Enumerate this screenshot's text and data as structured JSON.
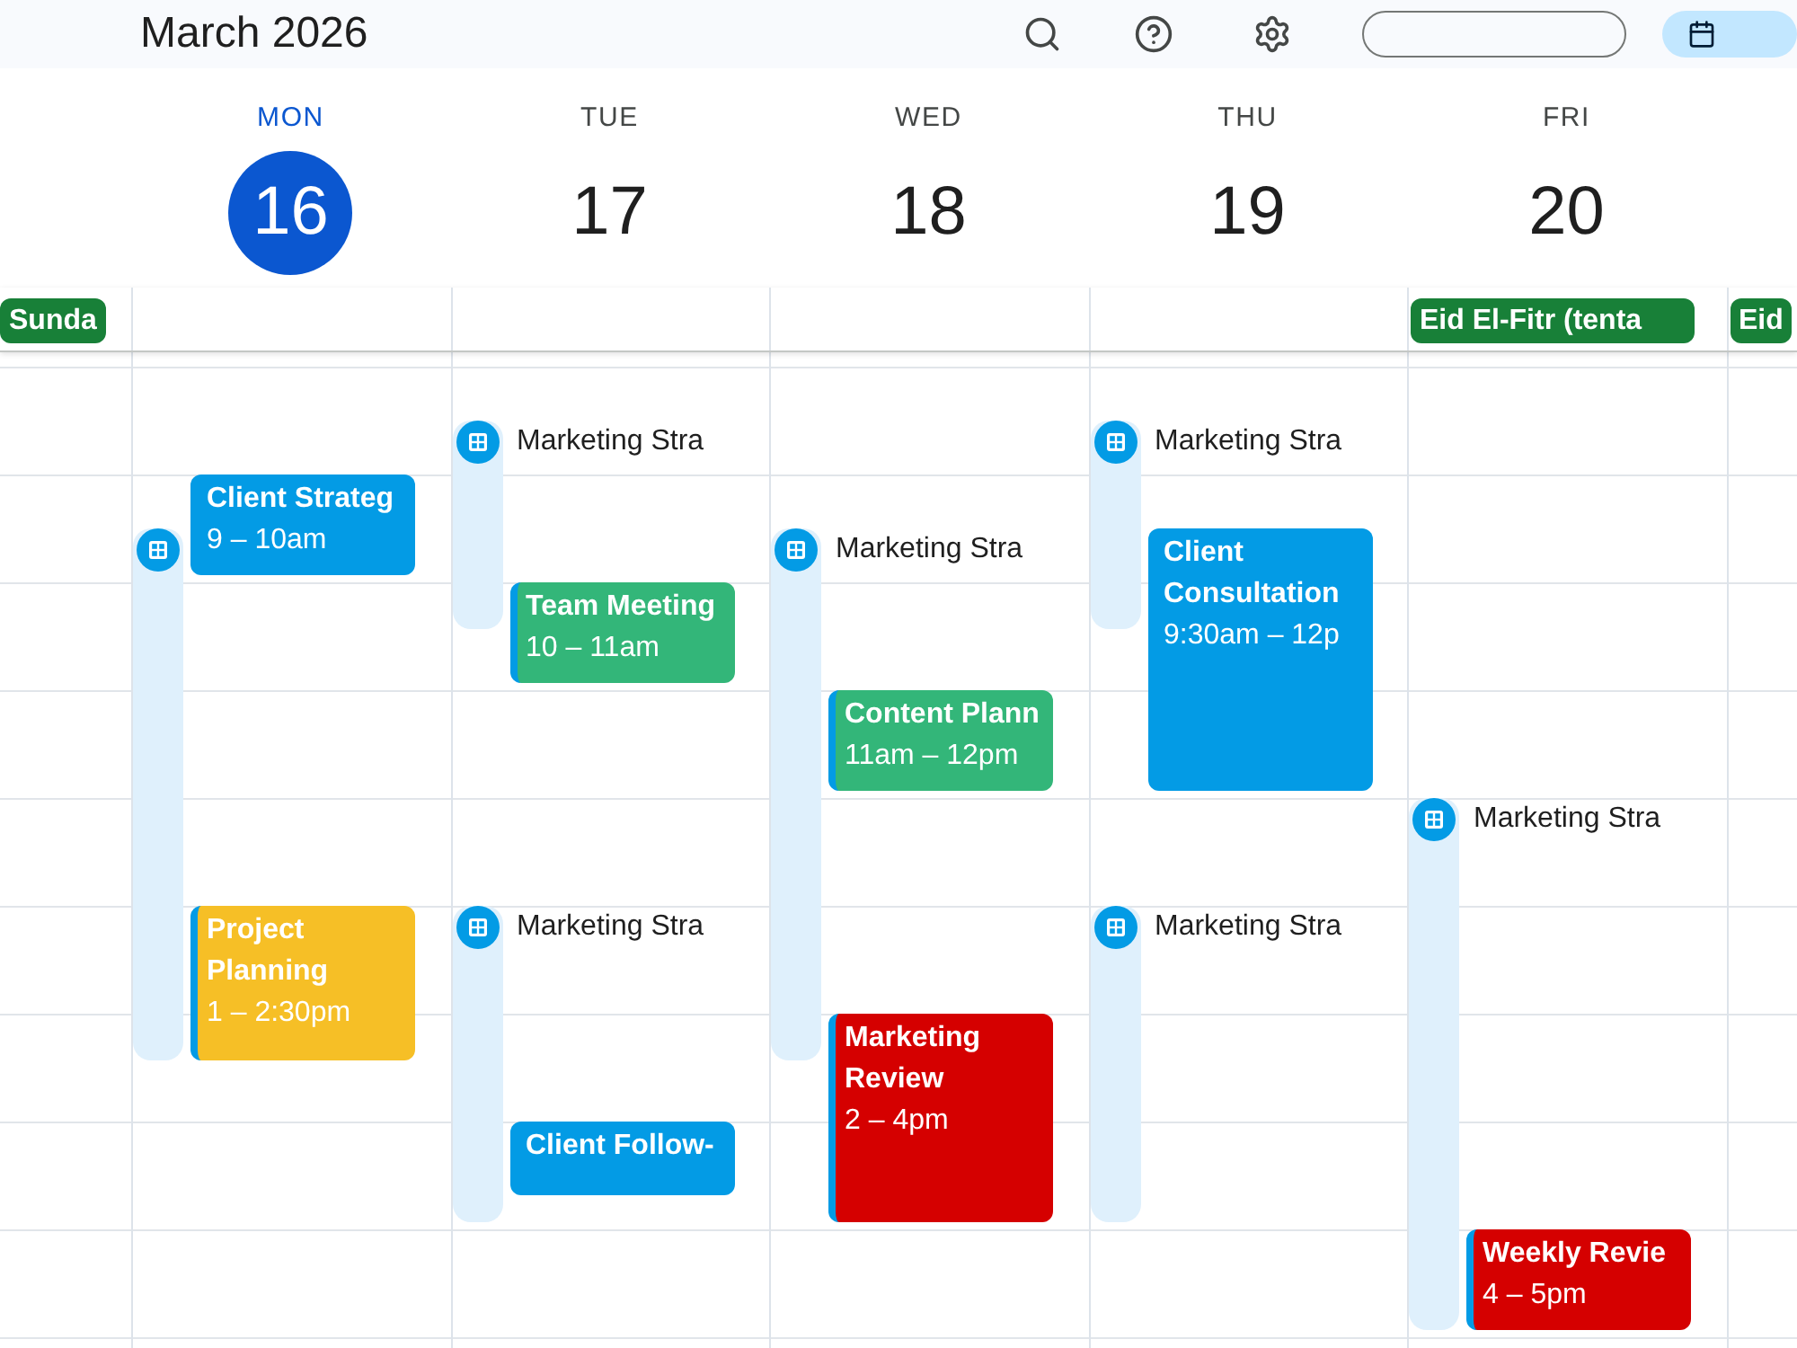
{
  "top_bar": {
    "title": "March 2026"
  },
  "days": [
    {
      "holidays": [
        {
          "label": "Sunda"
        }
      ]
    },
    {
      "day_name": "MON",
      "date": "16",
      "selected": true,
      "items": [
        {
          "kind": "schedule"
        },
        {
          "kind": "event",
          "title": "Client Strateg",
          "time": "9 – 10am",
          "color": "#039be5",
          "stripe": false
        },
        {
          "kind": "event",
          "title": "Project Planning",
          "time": "1 – 2:30pm",
          "color": "#f6bf26",
          "stripe": true
        }
      ]
    },
    {
      "day_name": "TUE",
      "date": "17",
      "selected": false,
      "items": [
        {
          "kind": "schedule",
          "title": "Marketing Stra"
        },
        {
          "kind": "event",
          "title": "Team Meeting",
          "time": "10 – 11am",
          "color": "#33b679",
          "stripe": true
        },
        {
          "kind": "schedule",
          "title": "Marketing Stra"
        },
        {
          "kind": "event",
          "title": "Client Follow-",
          "color": "#039be5",
          "stripe": false
        }
      ]
    },
    {
      "day_name": "WED",
      "date": "18",
      "selected": false,
      "items": [
        {
          "kind": "schedule",
          "title": "Marketing Stra"
        },
        {
          "kind": "event",
          "title": "Content Plann",
          "time": "11am – 12pm",
          "color": "#33b679",
          "stripe": true
        },
        {
          "kind": "event",
          "title": "Marketing Review",
          "time": "2 – 4pm",
          "color": "#d50000",
          "stripe": true
        }
      ]
    },
    {
      "day_name": "THU",
      "date": "19",
      "selected": false,
      "items": [
        {
          "kind": "schedule",
          "title": "Marketing Stra"
        },
        {
          "kind": "event",
          "title": "Client Consultation",
          "time": "9:30am – 12p",
          "color": "#039be5",
          "stripe": false
        },
        {
          "kind": "schedule",
          "title": "Marketing Stra"
        }
      ]
    },
    {
      "day_name": "FRI",
      "date": "20",
      "selected": false,
      "holidays": [
        {
          "label": "Eid El-Fitr (tenta"
        }
      ],
      "items": [
        {
          "kind": "schedule",
          "title": "Marketing Stra"
        },
        {
          "kind": "event",
          "title": "Weekly Revie",
          "time": "4 – 5pm",
          "color": "#d50000",
          "stripe": true
        }
      ]
    },
    {
      "holidays": [
        {
          "label": "Eid"
        }
      ]
    }
  ]
}
